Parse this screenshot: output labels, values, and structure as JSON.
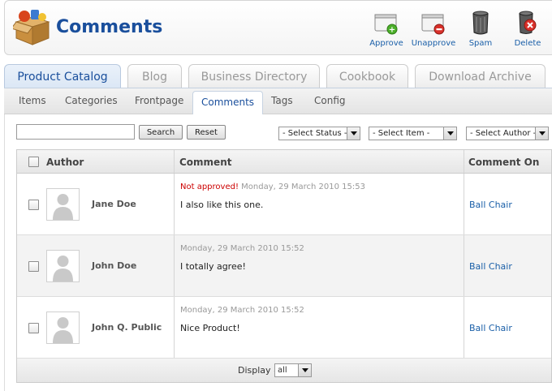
{
  "header": {
    "title": "Comments",
    "toolbar": [
      {
        "label": "Approve",
        "icon": "approve-icon"
      },
      {
        "label": "Unapprove",
        "icon": "unapprove-icon"
      },
      {
        "label": "Spam",
        "icon": "trash-can-icon"
      },
      {
        "label": "Delete",
        "icon": "delete-icon"
      }
    ]
  },
  "main_tabs": [
    "Product Catalog",
    "Blog",
    "Business Directory",
    "Cookbook",
    "Download Archive"
  ],
  "active_main_tab": "Product Catalog",
  "sub_tabs": [
    "Items",
    "Categories",
    "Frontpage",
    "Comments",
    "Tags",
    "Config"
  ],
  "active_sub_tab": "Comments",
  "filters": {
    "search_value": "",
    "search_button": "Search",
    "reset_button": "Reset",
    "status_select": "- Select Status -",
    "item_select": "- Select Item -",
    "author_select": "- Select Author -"
  },
  "table": {
    "headers": [
      "Author",
      "Comment",
      "Comment On"
    ],
    "rows": [
      {
        "author": "Jane Doe",
        "status": "Not approved!",
        "date": "Monday, 29 March 2010 15:53",
        "comment": "I also like this one.",
        "comment_on": "Ball Chair"
      },
      {
        "author": "John Doe",
        "status": "",
        "date": "Monday, 29 March 2010 15:52",
        "comment": "I totally agree!",
        "comment_on": "Ball Chair"
      },
      {
        "author": "John Q. Public",
        "status": "",
        "date": "Monday, 29 March 2010 15:52",
        "comment": "Nice Product!",
        "comment_on": "Ball Chair"
      }
    ],
    "footer": {
      "display_label": "Display #",
      "display_value": "all"
    }
  },
  "colors": {
    "accent": "#1a4f9c",
    "link": "#1a5fa8",
    "warning": "#cc0000"
  }
}
